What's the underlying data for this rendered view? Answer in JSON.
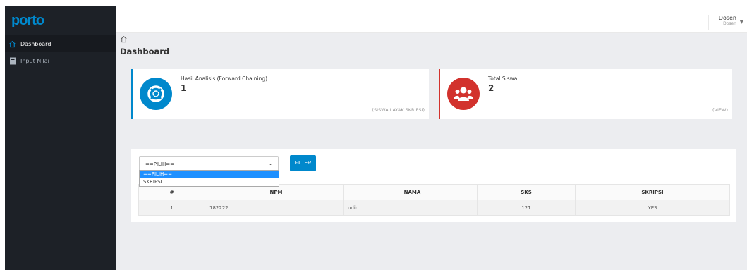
{
  "app": {
    "logo": "porto"
  },
  "sidebar": {
    "items": [
      {
        "label": "Dashboard",
        "icon": "home-icon"
      },
      {
        "label": "Input Nilai",
        "icon": "book-icon"
      }
    ]
  },
  "header": {
    "user_name": "Dosen",
    "user_role": "Dosen"
  },
  "page": {
    "title": "Dashboard"
  },
  "cards": [
    {
      "label": "Hasil Analisis (Forward Chaining)",
      "value": "1",
      "footer": "(SISWA LAYAK SKRIPSI)",
      "color": "#0088cc",
      "icon": "lifebuoy-icon"
    },
    {
      "label": "Total Siswa",
      "value": "2",
      "footer": "(VIEW)",
      "color": "#d2322d",
      "icon": "users-icon"
    }
  ],
  "filter": {
    "selected": "==PILIH==",
    "options": [
      "==PILIH==",
      "SKRIPSI"
    ],
    "button_label": "FILTER"
  },
  "table": {
    "headers": [
      "#",
      "NPM",
      "NAMA",
      "SKS",
      "SKRIPSI"
    ],
    "rows": [
      [
        "1",
        "182222",
        "udin",
        "121",
        "YES"
      ]
    ]
  },
  "colors": {
    "sidebar_bg": "#1d2127",
    "accent_blue": "#0088cc",
    "accent_red": "#d2322d"
  }
}
